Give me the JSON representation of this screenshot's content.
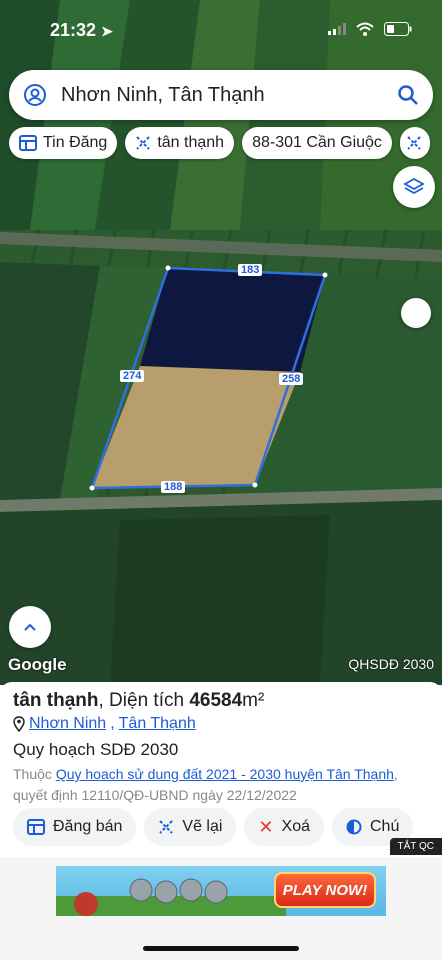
{
  "status_bar": {
    "time": "21:32"
  },
  "search": {
    "value": "Nhơn Ninh, Tân Thạnh"
  },
  "chips": [
    {
      "label": "Tin Đăng",
      "icon": "listing-icon"
    },
    {
      "label": "tân thạnh",
      "icon": "pin-tool-icon"
    },
    {
      "label": "88-301 Cần Giuộc",
      "icon": ""
    }
  ],
  "map": {
    "parcel_edges": {
      "top": "183",
      "right": "258",
      "left": "274",
      "bottom": "188"
    },
    "attribution": "Google",
    "overlay_label": "QHSDĐ 2030",
    "parcel_color": "#2f6fe0"
  },
  "sheet": {
    "title_name": "tân thạnh",
    "title_sep": ", Diện tích ",
    "area_value": "46584",
    "area_unit": "m²",
    "commune": "Nhơn Ninh",
    "comma": ",",
    "district": "Tân Thạnh",
    "plan_title": "Quy hoạch SDĐ 2030",
    "desc_prefix": "Thuộc ",
    "desc_link": "Quy hoach sử dung đất 2021 - 2030 huyện Tân Thạnh",
    "desc_suffix": ", quyết định 12110/QĐ-UBND ngày 22/12/2022",
    "actions": [
      {
        "label": "Đăng bán"
      },
      {
        "label": "Vẽ lại"
      },
      {
        "label": "Xoá"
      },
      {
        "label": "Chú"
      }
    ]
  },
  "ad": {
    "close_label": "TẮT QC",
    "play_label": "PLAY NOW!"
  },
  "colors": {
    "link": "#1e5bd6",
    "accent_blue": "#1e5bd6",
    "delete_red": "#e53935"
  }
}
